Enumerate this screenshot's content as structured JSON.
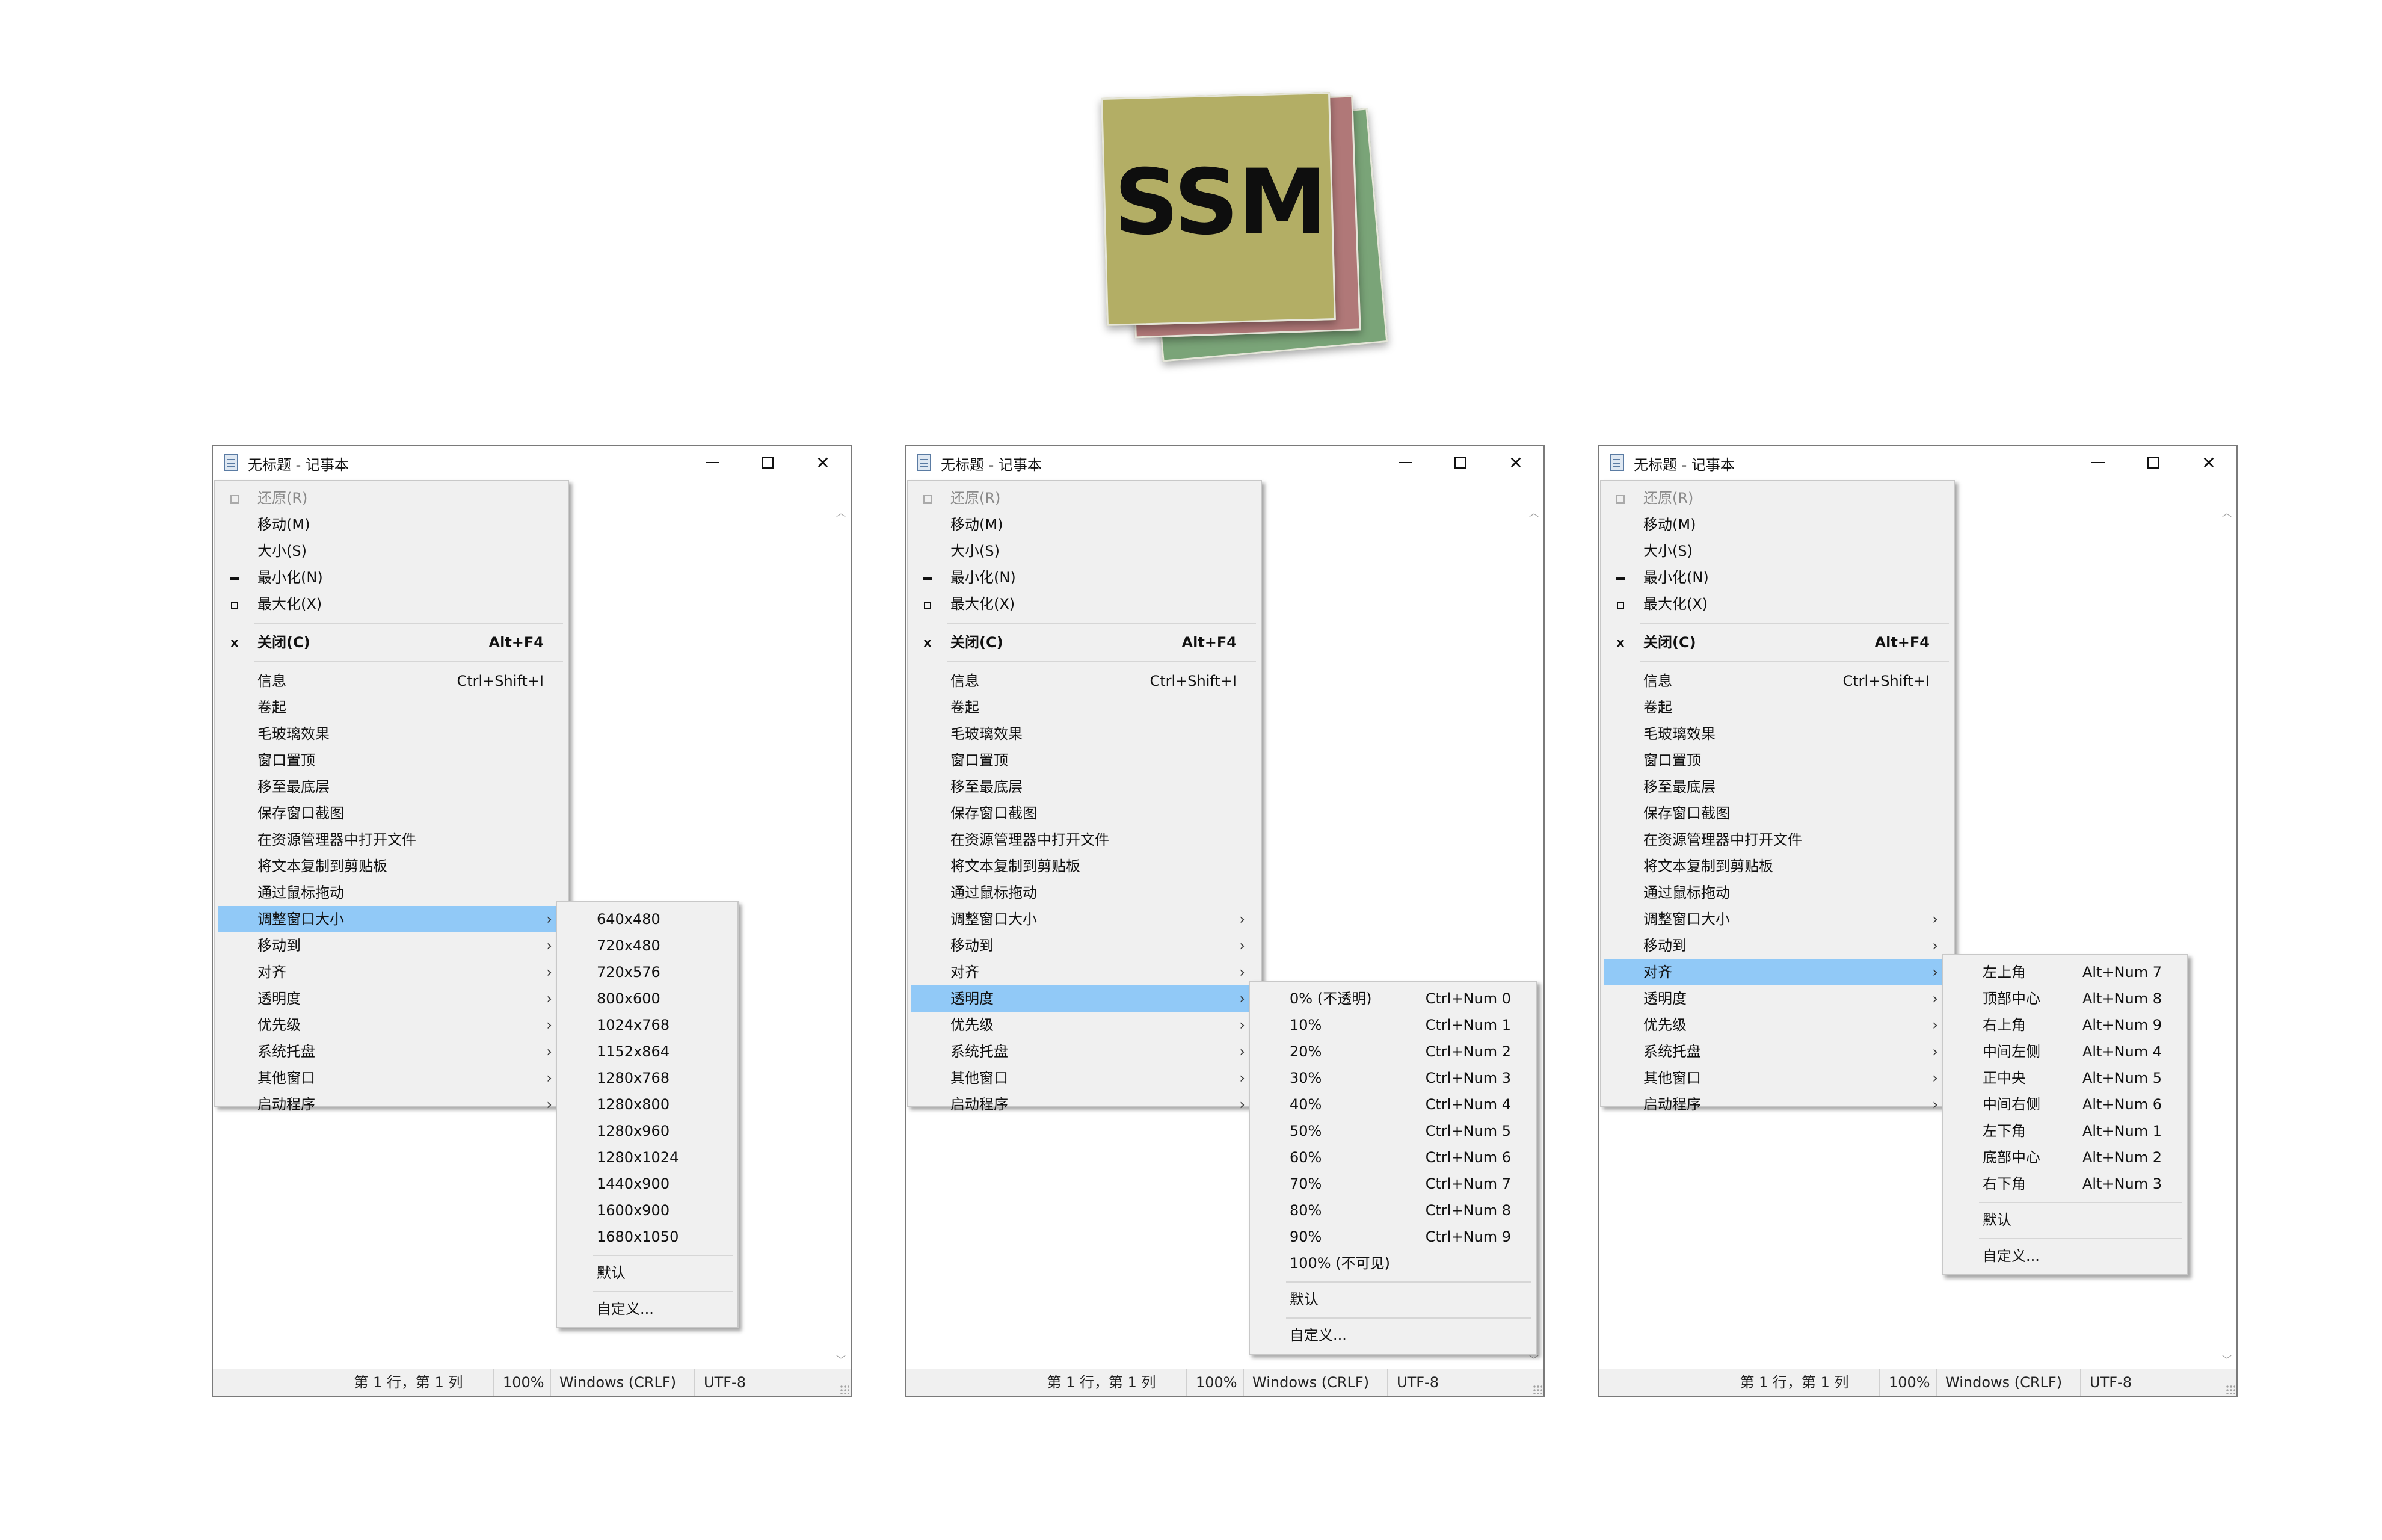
{
  "logo": {
    "text": "SSM"
  },
  "window": {
    "title": "无标题 - 记事本",
    "minimize_glyph": "—",
    "maximize_glyph": "☐",
    "close_glyph": "✕",
    "status": {
      "position": "第 1 行，第 1 列",
      "zoom": "100%",
      "line_ending": "Windows (CRLF)",
      "encoding": "UTF-8"
    }
  },
  "system_menu": {
    "items": [
      {
        "label": "还原(R)",
        "icon": "restore-icon",
        "disabled": true
      },
      {
        "label": "移动(M)"
      },
      {
        "label": "大小(S)"
      },
      {
        "label": "最小化(N)",
        "icon": "minimize-icon"
      },
      {
        "label": "最大化(X)",
        "icon": "maximize-icon"
      },
      {
        "label": "关闭(C)",
        "icon": "close-icon",
        "shortcut": "Alt+F4",
        "bold": true
      },
      {
        "label": "信息",
        "shortcut": "Ctrl+Shift+I"
      },
      {
        "label": "卷起"
      },
      {
        "label": "毛玻璃效果"
      },
      {
        "label": "窗口置顶"
      },
      {
        "label": "移至最底层"
      },
      {
        "label": "保存窗口截图"
      },
      {
        "label": "在资源管理器中打开文件"
      },
      {
        "label": "将文本复制到剪贴板"
      },
      {
        "label": "通过鼠标拖动"
      },
      {
        "label": "调整窗口大小",
        "submenu": true
      },
      {
        "label": "移动到",
        "submenu": true
      },
      {
        "label": "对齐",
        "submenu": true
      },
      {
        "label": "透明度",
        "submenu": true
      },
      {
        "label": "优先级",
        "submenu": true
      },
      {
        "label": "系统托盘",
        "submenu": true
      },
      {
        "label": "其他窗口",
        "submenu": true
      },
      {
        "label": "启动程序",
        "submenu": true
      }
    ],
    "close_icon_glyph": "x",
    "arrow_glyph": "›"
  },
  "resize_submenu": {
    "items": [
      "640x480",
      "720x480",
      "720x576",
      "800x600",
      "1024x768",
      "1152x864",
      "1280x768",
      "1280x800",
      "1280x960",
      "1280x1024",
      "1440x900",
      "1600x900",
      "1680x1050"
    ],
    "default": "默认",
    "custom": "自定义..."
  },
  "opacity_submenu": {
    "items": [
      {
        "label": "0% (不透明)",
        "shortcut": "Ctrl+Num 0"
      },
      {
        "label": "10%",
        "shortcut": "Ctrl+Num 1"
      },
      {
        "label": "20%",
        "shortcut": "Ctrl+Num 2"
      },
      {
        "label": "30%",
        "shortcut": "Ctrl+Num 3"
      },
      {
        "label": "40%",
        "shortcut": "Ctrl+Num 4"
      },
      {
        "label": "50%",
        "shortcut": "Ctrl+Num 5"
      },
      {
        "label": "60%",
        "shortcut": "Ctrl+Num 6"
      },
      {
        "label": "70%",
        "shortcut": "Ctrl+Num 7"
      },
      {
        "label": "80%",
        "shortcut": "Ctrl+Num 8"
      },
      {
        "label": "90%",
        "shortcut": "Ctrl+Num 9"
      },
      {
        "label": "100% (不可见)",
        "shortcut": ""
      }
    ],
    "default": "默认",
    "custom": "自定义..."
  },
  "align_submenu": {
    "items": [
      {
        "label": "左上角",
        "shortcut": "Alt+Num 7"
      },
      {
        "label": "顶部中心",
        "shortcut": "Alt+Num 8"
      },
      {
        "label": "右上角",
        "shortcut": "Alt+Num 9"
      },
      {
        "label": "中间左侧",
        "shortcut": "Alt+Num 4"
      },
      {
        "label": "正中央",
        "shortcut": "Alt+Num 5"
      },
      {
        "label": "中间右侧",
        "shortcut": "Alt+Num 6"
      },
      {
        "label": "左下角",
        "shortcut": "Alt+Num 1"
      },
      {
        "label": "底部中心",
        "shortcut": "Alt+Num 2"
      },
      {
        "label": "右下角",
        "shortcut": "Alt+Num 3"
      }
    ],
    "default": "默认",
    "custom": "自定义..."
  },
  "highlight_color": "#91c9f7"
}
